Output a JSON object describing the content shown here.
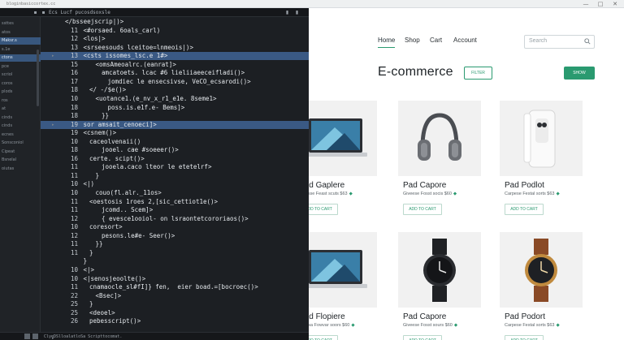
{
  "browser": {
    "tab_title": "bloginbasiccortex.cc",
    "window_controls": [
      "—",
      "□",
      "✕"
    ]
  },
  "editor": {
    "header_title": "Ecs  Lucf  pucosdsoxsle",
    "footer_text": "ClyeDSlloalatloSa  Scripttocomat.",
    "file_tree": [
      {
        "label": "ssttes",
        "active": false
      },
      {
        "label": "atos",
        "active": false
      },
      {
        "label": "Maksr.s",
        "active": true
      },
      {
        "label": "s.1e",
        "active": false
      },
      {
        "label": "ctons",
        "active": true
      },
      {
        "label": "pce",
        "active": false
      },
      {
        "label": "scriol",
        "active": false
      },
      {
        "label": "coros",
        "active": false
      },
      {
        "label": "plods",
        "active": false
      },
      {
        "label": "ros",
        "active": false
      },
      {
        "label": "at",
        "active": false
      },
      {
        "label": "cinds",
        "active": false
      },
      {
        "label": "cinds",
        "active": false
      },
      {
        "label": "ecnes",
        "active": false
      },
      {
        "label": "Sonsconiol",
        "active": false
      },
      {
        "label": "Cipeat",
        "active": false
      },
      {
        "label": "Bsnelal",
        "active": false
      },
      {
        "label": "oiutas",
        "active": false
      }
    ],
    "lines": [
      {
        "num": "",
        "text": "</bsseejscrip|)>",
        "indent": 0
      },
      {
        "num": "11",
        "text": "<#orsaed. 6oals_carl)",
        "indent": 3
      },
      {
        "num": "12",
        "text": "<los|>",
        "indent": 3
      },
      {
        "num": "13",
        "text": "<srseesouds lceitoe=lnmeois|)>",
        "indent": 3
      },
      {
        "num": "13",
        "text": "<csts issomes_lsc.e 1#>",
        "indent": 3
      },
      {
        "num": "15",
        "text": "<omsAmeoalrc.(eanrat]>",
        "indent": 5
      },
      {
        "num": "16",
        "text": "amcatoets. lcac #6 lieliiaeeceifladi()>",
        "indent": 6
      },
      {
        "num": "17",
        "text": "jomdiec le ensecsivse, VeCO_ecsarodi()>",
        "indent": 7
      },
      {
        "num": "18",
        "text": "</ -/$e()>",
        "indent": 4
      },
      {
        "num": "10",
        "text": "<uotance1.(e_nv_x_r1_e1e. 8seme1>",
        "indent": 5
      },
      {
        "num": "18",
        "text": "poss.is.e1f.e- Bems]>",
        "indent": 7
      },
      {
        "num": "18",
        "text": "}}",
        "indent": 6
      },
      {
        "num": "19",
        "text": "sor amsait_cenoeci]>",
        "indent": 3
      },
      {
        "num": "19",
        "text": "<csnem()>",
        "indent": 3
      },
      {
        "num": "10",
        "text": "caceolvenaii()",
        "indent": 4
      },
      {
        "num": "18",
        "text": "jooel. cae #soeeer()>",
        "indent": 6
      },
      {
        "num": "16",
        "text": "certe. scipt()>",
        "indent": 4
      },
      {
        "num": "11",
        "text": "jooela.caco lteor le etetelrf>",
        "indent": 6
      },
      {
        "num": "11",
        "text": "}",
        "indent": 5
      },
      {
        "num": "10",
        "text": "<|)",
        "indent": 3
      },
      {
        "num": "10",
        "text": "couo(fl.alr._11os>",
        "indent": 5
      },
      {
        "num": "11",
        "text": "<oestosis 1roes 2,[sic_cettiot1e()>",
        "indent": 4
      },
      {
        "num": "11",
        "text": "jcomd.. Scem]>",
        "indent": 6
      },
      {
        "num": "12",
        "text": "{ evesce1ooiol- on lsraontetcororiaos()>",
        "indent": 6
      },
      {
        "num": "10",
        "text": "coresort>",
        "indent": 4
      },
      {
        "num": "12",
        "text": "pesons.le#e- Seer()>",
        "indent": 6
      },
      {
        "num": "11",
        "text": "}}",
        "indent": 5
      },
      {
        "num": "11",
        "text": "}",
        "indent": 4
      },
      {
        "num": "",
        "text": "}",
        "indent": 3
      },
      {
        "num": "10",
        "text": "<|>",
        "indent": 3
      },
      {
        "num": "10",
        "text": "<|senosjeoolte()>",
        "indent": 3
      },
      {
        "num": "11",
        "text": "cnamaocle_sl#fI]} fen,  eier boad.=[bocroec()>",
        "indent": 4
      },
      {
        "num": "22",
        "text": "<Bsec]>",
        "indent": 5
      },
      {
        "num": "25",
        "text": "}",
        "indent": 4
      },
      {
        "num": "25",
        "text": "<deoel>",
        "indent": 4
      },
      {
        "num": "26",
        "text": "pebesscript()>",
        "indent": 4
      }
    ],
    "highlight_lines": [
      4,
      12
    ]
  },
  "store": {
    "nav": [
      "Home",
      "Shop",
      "Cart",
      "Account"
    ],
    "search_placeholder": "Search",
    "brand": "E-commerce",
    "filter_label": "FILTER",
    "promo_label": "SHOW",
    "products": [
      {
        "name": "Pad Gaplere",
        "meta": "Sivesse Feast scuts $63",
        "button": "ADD TO CART",
        "image": "laptop"
      },
      {
        "name": "Pad Capore",
        "meta": "Giveese Fosst socis $60",
        "button": "ADD TO CART",
        "image": "headphones"
      },
      {
        "name": "Pad Podlot",
        "meta": "Carpese Festal sorts $63",
        "button": "ADD TO CART",
        "image": "phone"
      },
      {
        "name": "Pad Flopiere",
        "meta": "Roulsa Fowvar soors $60",
        "button": "ADD TO CART",
        "image": "laptop"
      },
      {
        "name": "Pad Capore",
        "meta": "Giveese Fosst sours $60",
        "button": "ADD TO CART",
        "image": "watch-black"
      },
      {
        "name": "Pad Podort",
        "meta": "Carpese Festal sorts $63",
        "button": "ADD TO CART",
        "image": "watch-brown"
      }
    ],
    "accent_color": "#2a9a70"
  }
}
